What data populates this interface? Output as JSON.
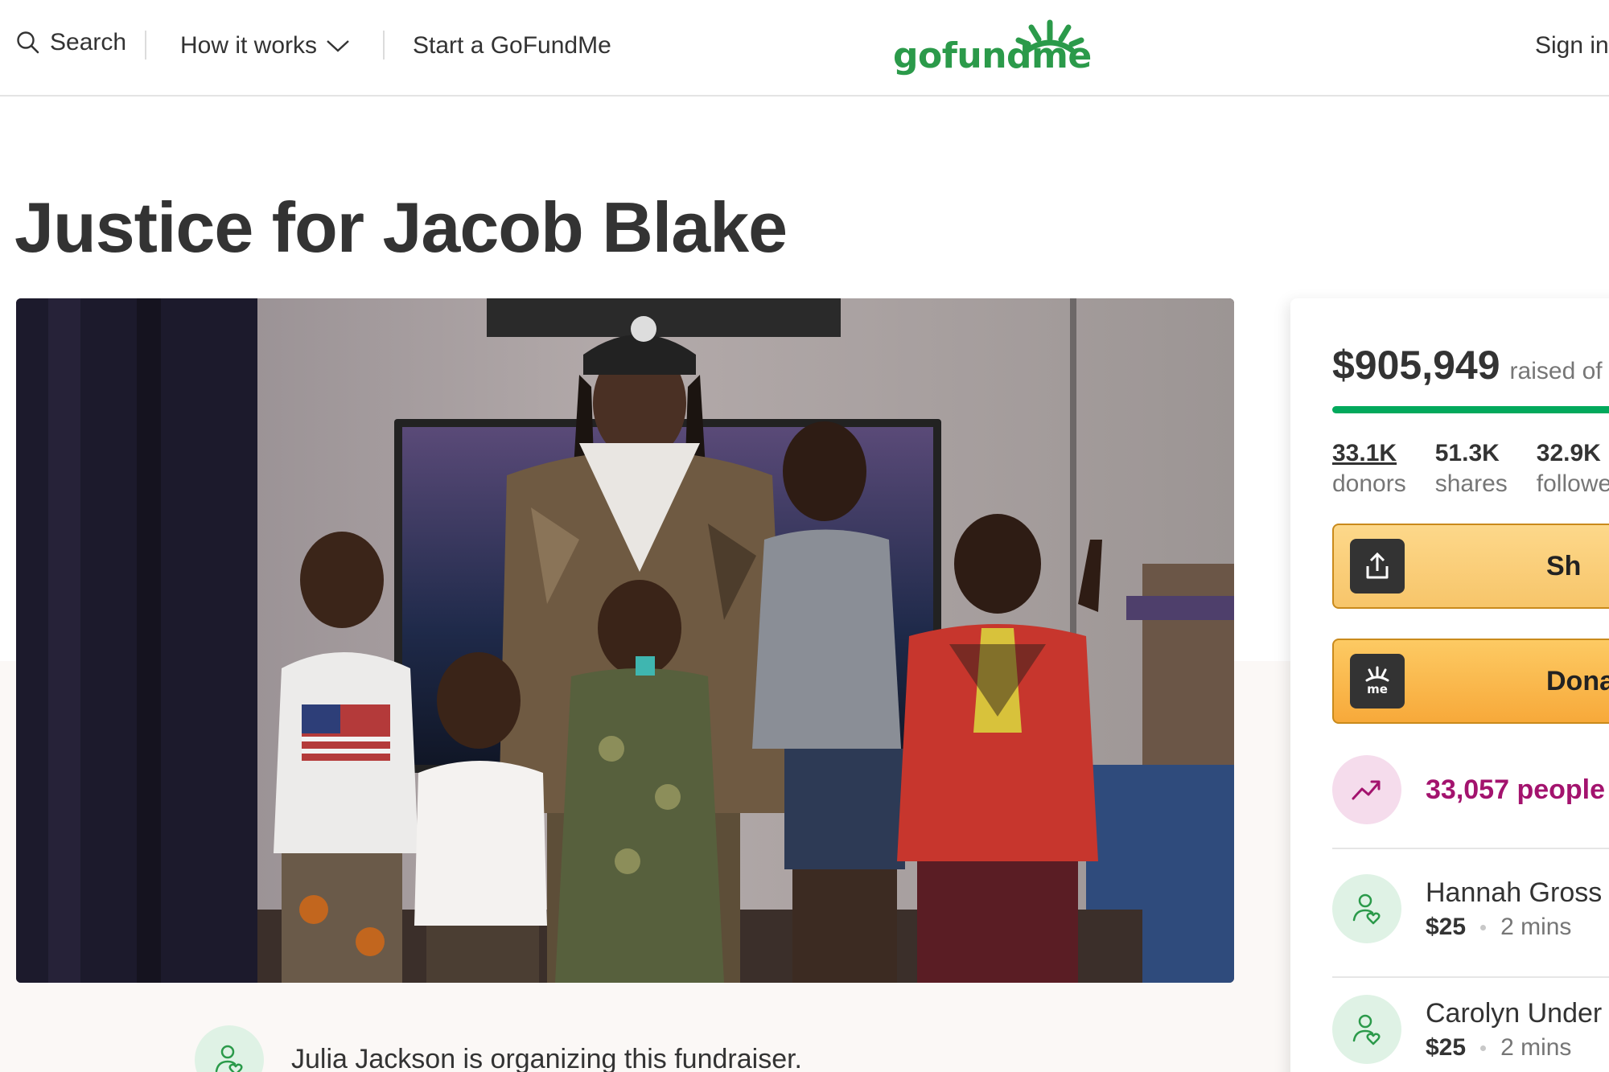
{
  "header": {
    "search_label": "Search",
    "how_it_works_label": "How it works",
    "start_label": "Start a GoFundMe",
    "logo_text": "gofundme",
    "sign_in_label": "Sign in"
  },
  "campaign": {
    "title": "Justice for Jacob Blake",
    "organizer_text": "Julia Jackson is organizing this fundraiser."
  },
  "card": {
    "raised_amount": "$905,949",
    "raised_suffix": "raised of",
    "progress_fraction": 1.0,
    "stats": [
      {
        "value": "33.1K",
        "label": "donors"
      },
      {
        "value": "51.3K",
        "label": "shares"
      },
      {
        "value": "32.9K",
        "label": "followe"
      }
    ],
    "share_label": "Sh",
    "donate_label": "Dona",
    "donate_icon_text": "me",
    "trend_text": "33,057 people",
    "donations": [
      {
        "name": "Hannah Gross",
        "amount": "$25",
        "time": "2 mins"
      },
      {
        "name": "Carolyn Under",
        "amount": "$25",
        "time": "2 mins"
      }
    ]
  },
  "colors": {
    "brand_green": "#02a95c",
    "logo_green": "#2b9a4a",
    "share_button": "#f7c56a",
    "donate_button": "#f7a93a",
    "trend_purple": "#a3136e"
  },
  "icons": [
    "search-icon",
    "chevron-down-icon",
    "share-upload-icon",
    "gofundme-sprout-icon",
    "trend-up-icon",
    "person-heart-icon"
  ]
}
